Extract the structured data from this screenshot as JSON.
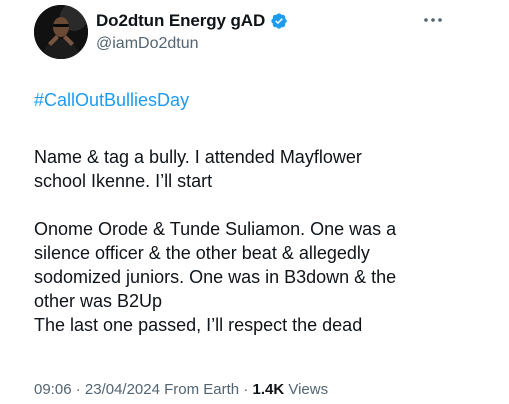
{
  "author": {
    "display_name": "Do2dtun Energy gAD",
    "handle": "@iamDo2dtun",
    "verified_icon": "verified-badge-icon",
    "verified_color": "#1d9bf0"
  },
  "more_icon": "more-horizontal-icon",
  "tweet": {
    "hashtag": "#CallOutBulliesDay",
    "lines": [
      "Name & tag a bully. I attended Mayflower",
      "school Ikenne. I’ll start",
      "",
      "Onome Orode & Tunde Suliamon. One was a",
      "silence officer & the other beat & allegedly",
      "sodomized juniors. One was in B3down & the",
      "other was B2Up",
      "The last one passed, I’ll respect the dead"
    ]
  },
  "meta": {
    "time": "09:06",
    "separator1": " · ",
    "date": "23/04/2024",
    "source": " From Earth",
    "separator2": " · ",
    "views_count": "1.4K",
    "views_label": " Views"
  },
  "colors": {
    "link": "#1d9bf0",
    "text": "#0f1419",
    "secondary": "#536471"
  }
}
